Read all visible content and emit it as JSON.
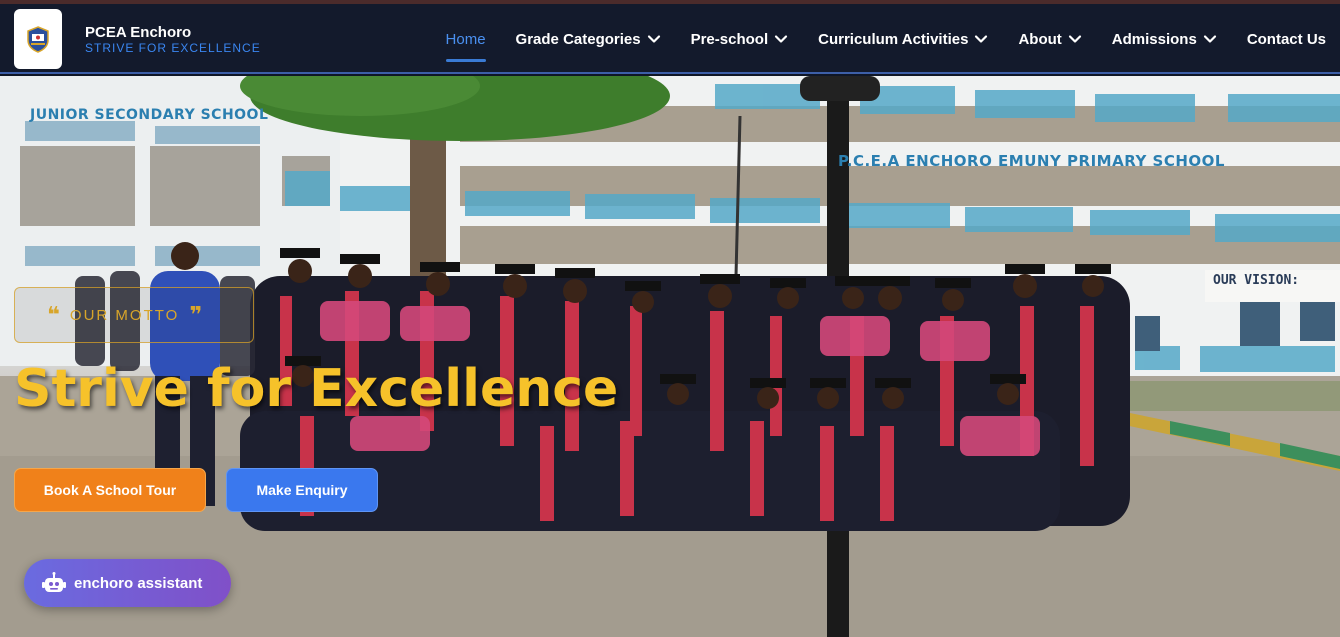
{
  "brand": {
    "name": "PCEA Enchoro",
    "tagline": "STRIVE FOR EXCELLENCE",
    "logo_icon": "school-crest-icon"
  },
  "nav": {
    "items": [
      {
        "label": "Home",
        "active": true,
        "dropdown": false
      },
      {
        "label": "Grade Categories",
        "active": false,
        "dropdown": true
      },
      {
        "label": "Pre-school",
        "active": false,
        "dropdown": true
      },
      {
        "label": "Curriculum Activities",
        "active": false,
        "dropdown": true
      },
      {
        "label": "About",
        "active": false,
        "dropdown": true
      },
      {
        "label": "Admissions",
        "active": false,
        "dropdown": true
      },
      {
        "label": "Contact Us",
        "active": false,
        "dropdown": false
      }
    ]
  },
  "hero": {
    "motto_label": "OUR MOTTO",
    "motto_open_quote": "❝",
    "motto_close_quote": "❞",
    "title": "Strive for Excellence",
    "buttons": {
      "tour": "Book A School Tour",
      "enquiry": "Make Enquiry"
    },
    "photo_signs": {
      "left_building": "JUNIOR SECONDARY SCHOOL",
      "right_building": "P.C.E.A ENCHORO EMUNY PRIMARY SCHOOL",
      "vision": "OUR VISION:"
    }
  },
  "assistant": {
    "label": "enchoro assistant",
    "icon": "robot-icon"
  },
  "colors": {
    "header_bg": "#131a2c",
    "accent_blue": "#3a86f0",
    "gold": "#f6c22a",
    "orange": "#f0811a",
    "button_blue": "#3a78ee"
  }
}
